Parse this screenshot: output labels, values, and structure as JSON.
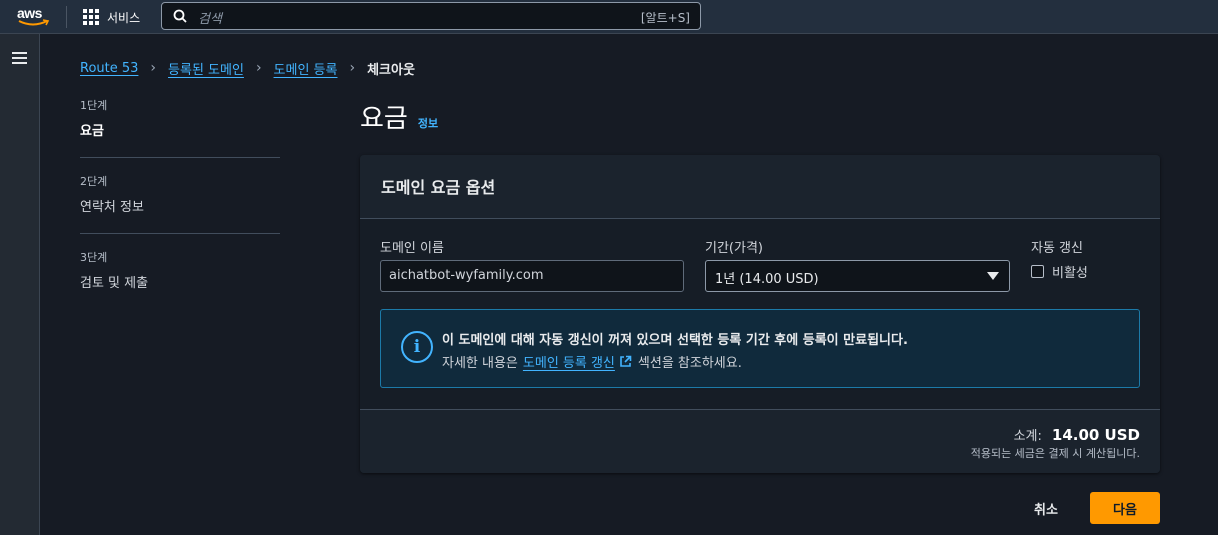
{
  "topnav": {
    "logo_text": "aws",
    "services_label": "서비스",
    "search_placeholder": "검색",
    "search_shortcut": "[알트+S]"
  },
  "breadcrumb": {
    "items": [
      "Route 53",
      "등록된 도메인",
      "도메인 등록"
    ],
    "current": "체크아웃"
  },
  "steps": [
    {
      "num": "1단계",
      "title": "요금",
      "active": true
    },
    {
      "num": "2단계",
      "title": "연락처 정보",
      "active": false
    },
    {
      "num": "3단계",
      "title": "검토 및 제출",
      "active": false
    }
  ],
  "page": {
    "title": "요금",
    "info_link": "정보"
  },
  "panel": {
    "title": "도메인 요금 옵션",
    "domain_label": "도메인 이름",
    "domain_value": "aichatbot-wyfamily.com",
    "period_label": "기간(가격)",
    "period_value": "1년 (14.00 USD)",
    "renew_label": "자동 갱신",
    "renew_checkbox_label": "비활성",
    "renew_checked": false,
    "alert": {
      "line1": "이 도메인에 대해 자동 갱신이 꺼져 있으며 선택한 등록 기간 후에 등록이 만료됩니다.",
      "line2_prefix": "자세한 내용은",
      "line2_link": "도메인 등록 갱신",
      "line2_suffix": "섹션을 참조하세요."
    },
    "subtotal_label": "소계:",
    "subtotal_value": "14.00 USD",
    "tax_note": "적용되는 세금은 결제 시 계산됩니다."
  },
  "actions": {
    "cancel": "취소",
    "next": "다음"
  },
  "colors": {
    "accent_link": "#42b4ff",
    "primary_button": "#ff9900",
    "topnav_bg": "#232f3e"
  }
}
